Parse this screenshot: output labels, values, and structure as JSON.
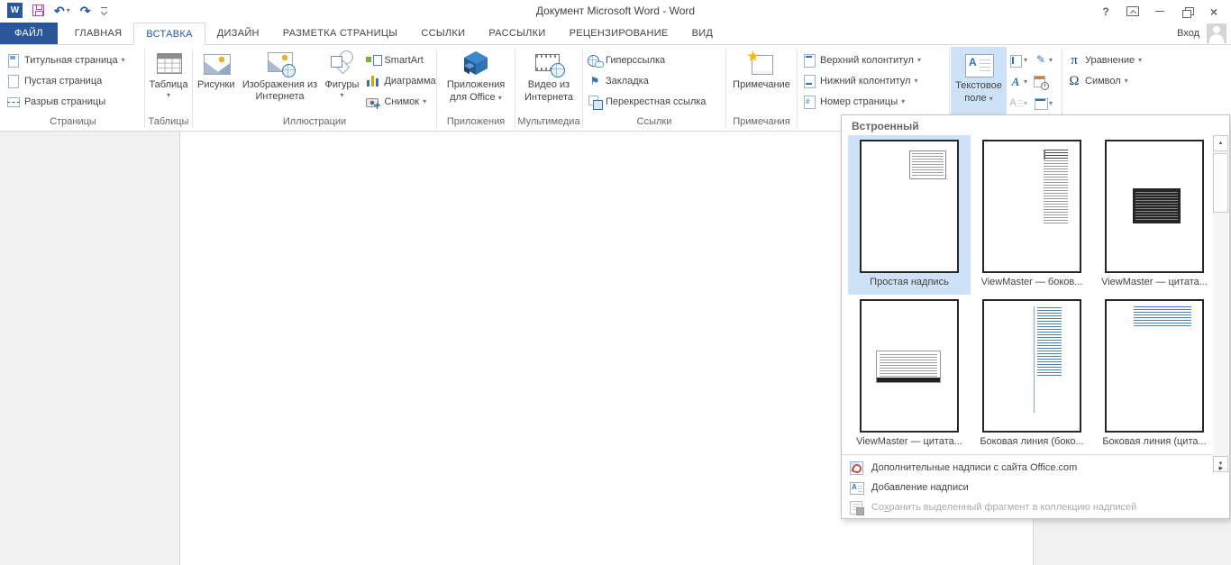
{
  "window": {
    "title": "Документ Microsoft Word - Word",
    "sign_in": "Вход"
  },
  "icons": {
    "dropdown": "▾",
    "submenu_arrow": "▸",
    "scroll_up": "▲",
    "scroll_down": "▼",
    "undo": "↶",
    "redo": "↷",
    "help": "?",
    "close": "×",
    "bookmark_flag": "⚑",
    "signature_pen": "✎",
    "pi": "π",
    "omega": "Ω",
    "wordart_letter": "А",
    "textbox_letter": "A",
    "word_logo_letter": "W"
  },
  "tabs": {
    "file": "ФАЙЛ",
    "items": [
      "ГЛАВНАЯ",
      "ВСТАВКА",
      "ДИЗАЙН",
      "РАЗМЕТКА СТРАНИЦЫ",
      "ССЫЛКИ",
      "РАССЫЛКИ",
      "РЕЦЕНЗИРОВАНИЕ",
      "ВИД"
    ],
    "active": "ВСТАВКА"
  },
  "ribbon": {
    "pages": {
      "label": "Страницы",
      "cover_page": "Титульная страница",
      "blank_page": "Пустая страница",
      "page_break": "Разрыв страницы"
    },
    "tables": {
      "label": "Таблицы",
      "table": "Таблица"
    },
    "illustrations": {
      "label": "Иллюстрации",
      "pictures": "Рисунки",
      "online_pictures": "Изображения из Интернета",
      "shapes": "Фигуры",
      "smartart": "SmartArt",
      "chart": "Диаграмма",
      "screenshot": "Снимок"
    },
    "apps": {
      "label": "Приложения",
      "line1": "Приложения",
      "line2": "для Office"
    },
    "media": {
      "label": "Мультимедиа",
      "line1": "Видео из",
      "line2": "Интернета"
    },
    "links": {
      "label": "Ссылки",
      "hyperlink": "Гиперссылка",
      "bookmark": "Закладка",
      "cross_reference": "Перекрестная ссылка"
    },
    "comments": {
      "label": "Примечания",
      "comment": "Примечание"
    },
    "header_footer": {
      "header": "Верхний колонтитул",
      "footer": "Нижний колонтитул",
      "page_number": "Номер страницы"
    },
    "text": {
      "textbox_line1": "Текстовое",
      "textbox_line2": "поле"
    },
    "symbols": {
      "equation": "Уравнение",
      "symbol": "Символ"
    }
  },
  "textbox_menu": {
    "header": "Встроенный",
    "gallery": [
      {
        "label": "Простая надпись",
        "selected": true
      },
      {
        "label": "ViewMaster — боков...",
        "selected": false
      },
      {
        "label": "ViewMaster — цитата...",
        "selected": false
      },
      {
        "label": "ViewMaster — цитата...",
        "selected": false
      },
      {
        "label": "Боковая линия (боко...",
        "selected": false
      },
      {
        "label": "Боковая линия (цита...",
        "selected": false
      }
    ],
    "menu": [
      {
        "pre": "",
        "accel": "Д",
        "post": "ополнительные надписи с сайта Office.com",
        "disabled": false,
        "has_submenu": true
      },
      {
        "pre": "",
        "accel": "Д",
        "post": "обавление надписи",
        "disabled": false,
        "has_submenu": false
      },
      {
        "pre": "Со",
        "accel": "х",
        "post": "ранить выделенный фрагмент в коллекцию надписей",
        "disabled": true,
        "has_submenu": false
      }
    ]
  },
  "colors": {
    "accent_blue": "#2B579A",
    "highlight_blue": "#CDE2F6",
    "ribbon_text": "#444444",
    "group_label": "#666666"
  }
}
